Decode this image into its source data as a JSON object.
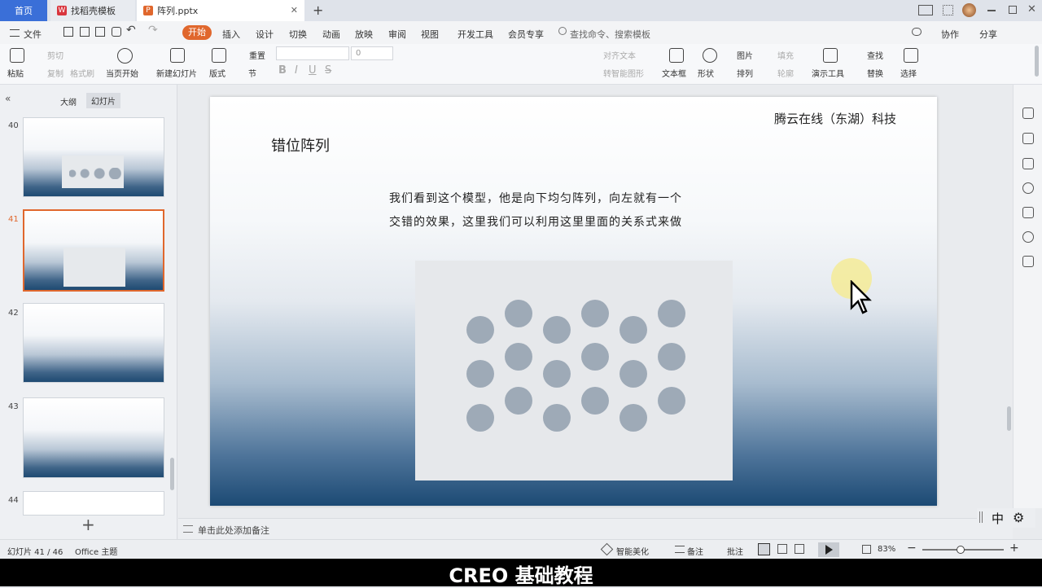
{
  "tabs": [
    {
      "label": "首页"
    },
    {
      "label": "找稻壳模板"
    },
    {
      "label": "阵列.pptx"
    }
  ],
  "menu": {
    "file": "文件",
    "items": [
      "开始",
      "插入",
      "设计",
      "切换",
      "动画",
      "放映",
      "审阅",
      "视图",
      "开发工具",
      "会员专享"
    ],
    "search_placeholder": "查找命令、搜索模板",
    "collab": "协作",
    "share": "分享"
  },
  "toolbar": {
    "paste": "粘贴",
    "cut": "剪切",
    "copy": "复制",
    "format_painter": "格式刷",
    "from_current": "当页开始",
    "new_slide": "新建幻灯片",
    "layout": "版式",
    "section": "节",
    "reset": "重置",
    "font_size": "0",
    "align_text": "对齐文本",
    "smart_art": "转智能图形",
    "textbox": "文本框",
    "shape": "形状",
    "picture": "图片",
    "arrange": "排列",
    "fill": "填充",
    "outline": "轮廓",
    "present_tool": "演示工具",
    "find": "查找",
    "replace": "替换",
    "select": "选择"
  },
  "left": {
    "outline_tab": "大纲",
    "slides_tab": "幻灯片",
    "numbers": [
      "40",
      "41",
      "42",
      "43",
      "44"
    ],
    "add": "+"
  },
  "slide": {
    "company": "腾云在线（东湖）科技",
    "title": "错位阵列",
    "body_line1": "我们看到这个模型，他是向下均匀阵列，向左就有一个",
    "body_line2": "交错的效果，这里我们可以利用这里里面的关系式来做"
  },
  "notes": {
    "placeholder": "单击此处添加备注"
  },
  "status": {
    "slide_info": "幻灯片 41 / 46",
    "theme": "Office 主题",
    "beautify": "智能美化",
    "notes": "备注",
    "comments": "批注",
    "zoom": "83%"
  },
  "ime": {
    "lang": "中"
  },
  "subtitle": "CREO 基础教程",
  "colors": {
    "accent": "#e0672d",
    "dot": "#9eaab7",
    "slide_bottom": "#1c4a74"
  }
}
